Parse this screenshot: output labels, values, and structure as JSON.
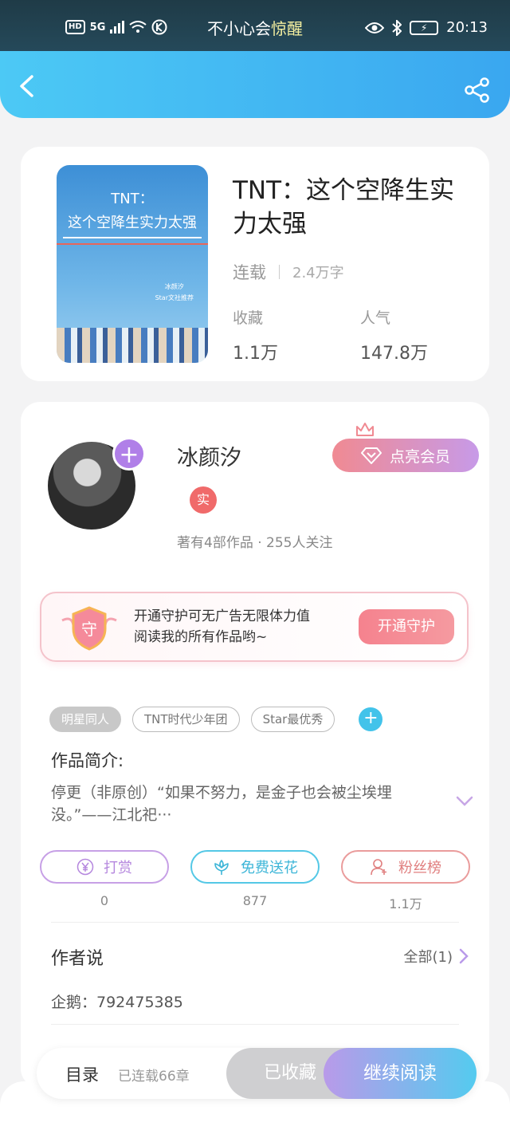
{
  "status_bar": {
    "hd": "HD",
    "network": "5G",
    "notification": "不小心会",
    "notification_highlight": "惊醒",
    "time": "20:13"
  },
  "header": {
    "back_icon": "back-arrow-icon",
    "share_icon": "share-icon"
  },
  "book": {
    "cover_line1": "TNT：",
    "cover_line2": "这个空降生实力太强",
    "cover_author": "冰颜汐",
    "cover_publisher": "Star文社推荐",
    "title": "TNT：这个空降生实力太强",
    "status": "连载",
    "word_count": "2.4万字",
    "favorites_label": "收藏",
    "favorites_value": "1.1万",
    "popularity_label": "人气",
    "popularity_value": "147.8万"
  },
  "author": {
    "name": "冰颜汐",
    "real_badge": "实",
    "meta": "著有4部作品 · 255人关注",
    "vip_button": "点亮会员"
  },
  "guard": {
    "shield_text": "守",
    "line1": "开通守护可无广告无限体力值",
    "line2": "阅读我的所有作品哟~",
    "button": "开通守护"
  },
  "tags": [
    "明星同人",
    "TNT时代少年团",
    "Star最优秀"
  ],
  "intro": {
    "heading": "作品简介:",
    "text": "停更（非原创）“如果不努力，是金子也会被尘埃埋没。”——江北祀···"
  },
  "actions": {
    "tip_label": "打赏",
    "tip_count": "0",
    "flower_label": "免费送花",
    "flower_count": "877",
    "fans_label": "粉丝榜",
    "fans_count": "1.1万"
  },
  "author_says": {
    "heading": "作者说",
    "all_link": "全部(1)",
    "text": "企鹅：792475385"
  },
  "bottom_bar": {
    "toc": "目录",
    "chapters": "已连载66章",
    "collected": "已收藏",
    "continue": "继续阅读"
  },
  "colors": {
    "header_start": "#4cc9f5",
    "header_end": "#3aa7f0",
    "accent_purple": "#b07fe8",
    "accent_pink": "#f5828e",
    "accent_cyan": "#42c3ea"
  }
}
